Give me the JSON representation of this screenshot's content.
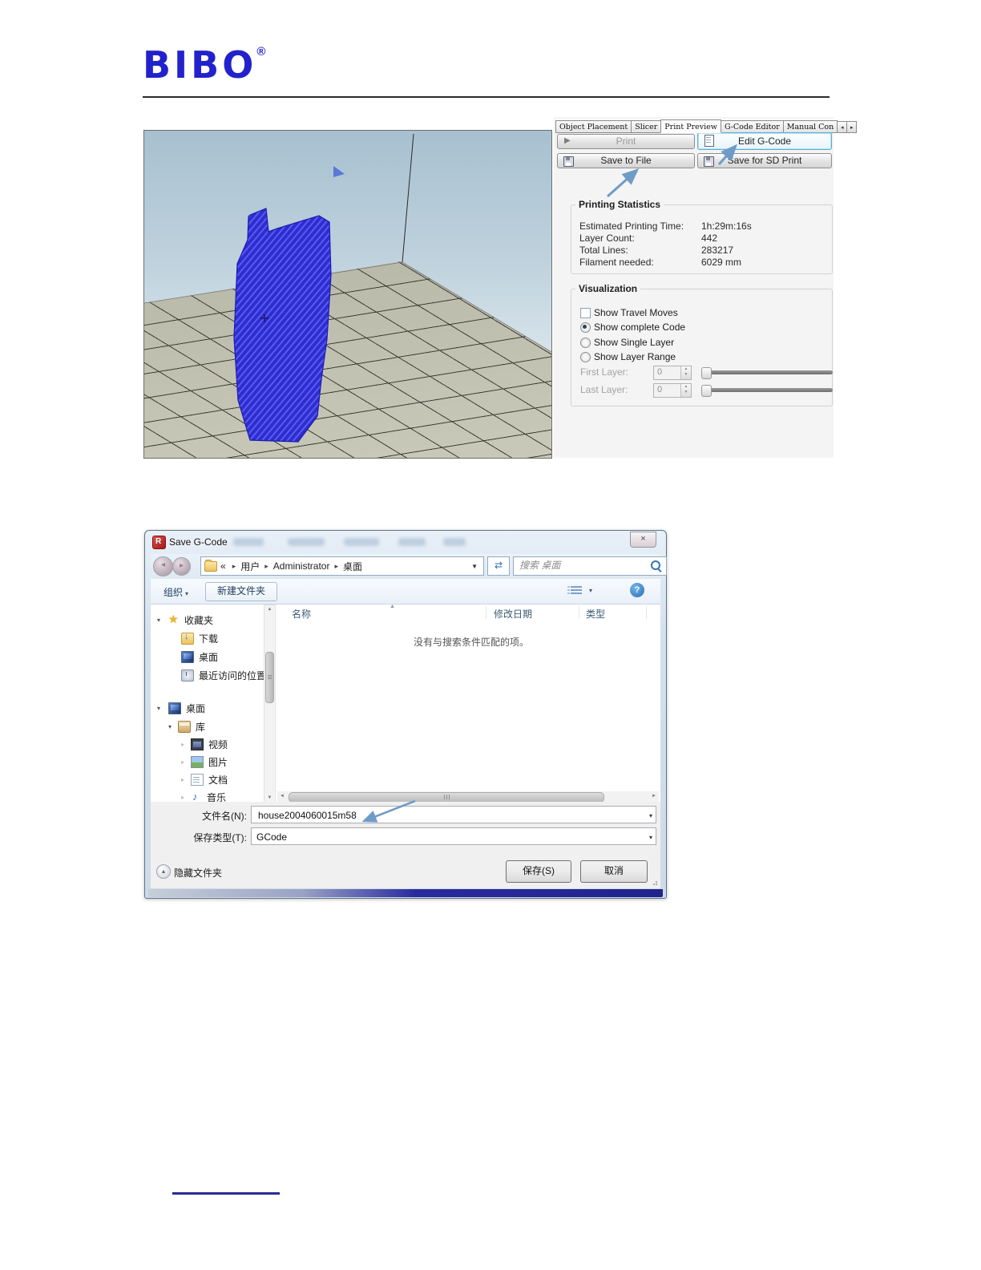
{
  "page": {
    "logo": "BIBO",
    "reg": "®"
  },
  "rep": {
    "tabs": [
      {
        "label": "Object Placement"
      },
      {
        "label": "Slicer"
      },
      {
        "label": "Print Preview"
      },
      {
        "label": "G-Code Editor"
      },
      {
        "label": "Manual Con"
      }
    ],
    "active_tab": "Print Preview",
    "buttons": {
      "print": "Print",
      "edit": "Edit G-Code",
      "save_file": "Save to File",
      "save_sd": "Save for SD Print"
    },
    "stats": {
      "title": "Printing Statistics",
      "rows": [
        {
          "label": "Estimated Printing Time:",
          "value": "1h:29m:16s"
        },
        {
          "label": "Layer Count:",
          "value": "442"
        },
        {
          "label": "Total Lines:",
          "value": "283217"
        },
        {
          "label": "Filament needed:",
          "value": "6029 mm"
        }
      ]
    },
    "vis": {
      "title": "Visualization",
      "travel": "Show Travel Moves",
      "complete": "Show complete Code",
      "single": "Show Single Layer",
      "range": "Show Layer Range",
      "selected": "Show complete Code",
      "first_label": "First Layer:",
      "first_value": "0",
      "last_label": "Last Layer:",
      "last_value": "0"
    }
  },
  "dlg": {
    "title": "Save G-Code",
    "crumb_prefix": "«",
    "crumbs": [
      {
        "label": "用户"
      },
      {
        "label": "Administrator"
      },
      {
        "label": "桌面"
      }
    ],
    "search_placeholder": "搜索 桌面",
    "organize": "组织",
    "new_folder": "新建文件夹",
    "columns": [
      {
        "label": "名称"
      },
      {
        "label": "修改日期"
      },
      {
        "label": "类型"
      }
    ],
    "empty": "没有与搜索条件匹配的项。",
    "sidebar": [
      {
        "label": "收藏夹"
      },
      {
        "label": "下载"
      },
      {
        "label": "桌面"
      },
      {
        "label": "最近访问的位置"
      },
      {
        "label": "桌面"
      },
      {
        "label": "库"
      },
      {
        "label": "视频"
      },
      {
        "label": "图片"
      },
      {
        "label": "文档"
      },
      {
        "label": "音乐"
      }
    ],
    "filename_label": "文件名(N):",
    "filename_value": "house2004060015m58",
    "savetype_label": "保存类型(T):",
    "savetype_value": "GCode",
    "hide_folders": "隐藏文件夹",
    "save": "保存(S)",
    "cancel": "取消"
  },
  "icons": {
    "play": "▶",
    "caret": "▼",
    "caret_s": "▾",
    "chevron": "▸",
    "scroll_left": "◂",
    "scroll_right": "▸",
    "guillemet": "«",
    "close": "×",
    "refresh": "⇄",
    "help": "?",
    "sort": "▲",
    "up": "▲",
    "down": "▼",
    "left": "◄",
    "right": "►",
    "hide_up": "▴"
  },
  "colors": {
    "logo_blue": "#2222cc",
    "model_blue": "#2d2dd0",
    "annotation_arrow": "#6f9cc6",
    "edit_highlight": "#56aed8",
    "navy_strip": "#23238c"
  }
}
